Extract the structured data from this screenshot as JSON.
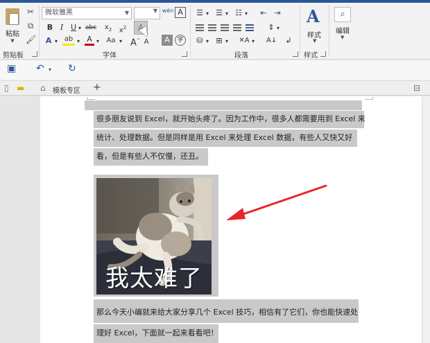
{
  "ribbon": {
    "clipboard": {
      "paste_label": "粘贴",
      "group_label": "剪贴板"
    },
    "font": {
      "font_name": "微软雅黑",
      "font_size": "",
      "phonetic_label": "wén",
      "group_label": "字体",
      "aa_label": "Aa",
      "strike_label": "abc"
    },
    "paragraph": {
      "group_label": "段落"
    },
    "styles": {
      "styles_label": "样式",
      "group_label": "样式"
    },
    "editing": {
      "edit_label": "编辑"
    }
  },
  "tabs": {
    "template_label": "模板专区",
    "add_label": "+"
  },
  "document": {
    "paragraph1": [
      "很多朋友说到 Excel，就开始头疼了。因为工作中，很多人都需要用到 Excel 来",
      "统计、处理数据。但是同样是用 Excel 来处理 Excel 数据，有些人又快又好",
      "看，但是有些人不仅慢，还丑。"
    ],
    "image_caption": "我太难了",
    "paragraph2": [
      "那么今天小编就来给大家分享几个 Excel 技巧，相信有了它们，你也能快速处",
      "理好 Excel，下面就一起来看看吧！"
    ]
  },
  "colors": {
    "accent": "#2b579a",
    "selection": "#c9c9c9",
    "arrow": "#e8262a"
  }
}
